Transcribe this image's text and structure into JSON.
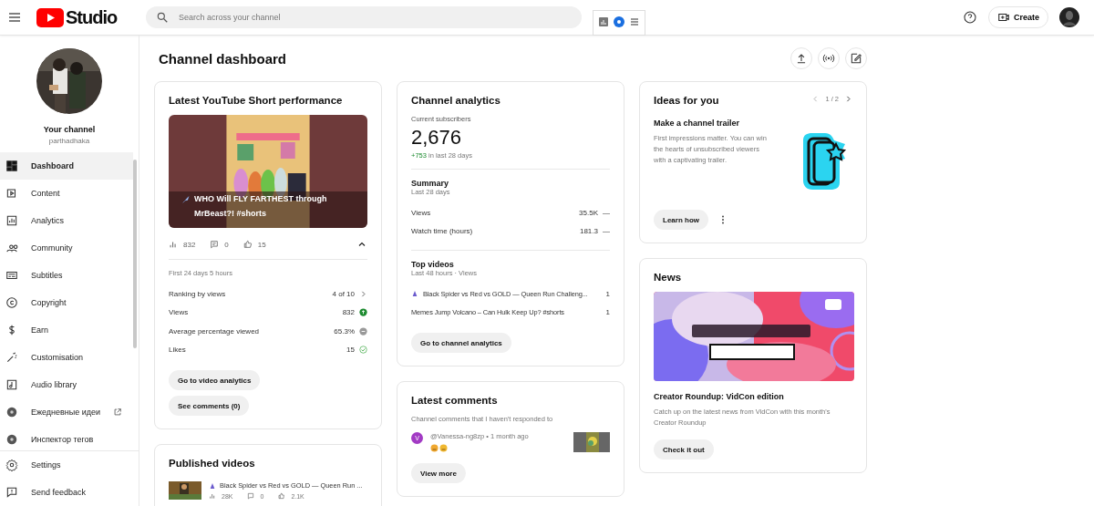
{
  "header": {
    "logo": "Studio",
    "search_placeholder": "Search across your channel",
    "create": "Create"
  },
  "sidebar": {
    "channel_label": "Your channel",
    "channel_handle": "parthadhaka",
    "items": [
      {
        "label": "Dashboard",
        "selected": true,
        "external": false
      },
      {
        "label": "Content",
        "selected": false,
        "external": false
      },
      {
        "label": "Analytics",
        "selected": false,
        "external": false
      },
      {
        "label": "Community",
        "selected": false,
        "external": false
      },
      {
        "label": "Subtitles",
        "selected": false,
        "external": false
      },
      {
        "label": "Copyright",
        "selected": false,
        "external": false
      },
      {
        "label": "Earn",
        "selected": false,
        "external": false
      },
      {
        "label": "Customisation",
        "selected": false,
        "external": false
      },
      {
        "label": "Audio library",
        "selected": false,
        "external": false
      },
      {
        "label": "Ежедневные идеи",
        "selected": false,
        "external": true
      },
      {
        "label": "Инспектор тегов",
        "selected": false,
        "external": false
      }
    ],
    "footer_items": [
      {
        "label": "Settings"
      },
      {
        "label": "Send feedback"
      }
    ]
  },
  "page_title": "Channel dashboard",
  "short_card": {
    "title": "Latest YouTube Short performance",
    "video_title": "WHO Will FLY FARTHEST through MrBeast?! #shorts",
    "views": "832",
    "comments": "0",
    "likes": "15",
    "period": "First 24 days 5 hours",
    "metrics": [
      {
        "label": "Ranking by views",
        "value": "4 of 10",
        "kind": "link"
      },
      {
        "label": "Views",
        "value": "832",
        "kind": "up"
      },
      {
        "label": "Average percentage viewed",
        "value": "65.3%",
        "kind": "neutral"
      },
      {
        "label": "Likes",
        "value": "15",
        "kind": "check"
      }
    ],
    "buttons": [
      "Go to video analytics",
      "See comments (0)"
    ]
  },
  "published_card": {
    "title": "Published videos",
    "videos": [
      {
        "title": "Black Spider vs Red vs GOLD — Queen Run ...",
        "views": "28K",
        "comments": "0",
        "likes": "2.1K"
      }
    ]
  },
  "analytics_card": {
    "title": "Channel analytics",
    "subscribers_label": "Current subscribers",
    "subscribers": "2,676",
    "change": "+753",
    "change_suffix": "in last 28 days",
    "summary_title": "Summary",
    "summary_period": "Last 28 days",
    "summary": [
      {
        "label": "Views",
        "value": "35.5K",
        "trend": "—"
      },
      {
        "label": "Watch time (hours)",
        "value": "181.3",
        "trend": "—"
      }
    ],
    "top_title": "Top videos",
    "top_period": "Last 48 hours · Views",
    "top_videos": [
      {
        "title": "Black Spider vs Red vs GOLD — Queen Run Challeng...",
        "value": "1",
        "short_icon": true
      },
      {
        "title": "Memes Jump Volcano – Can Hulk Keep Up? #shorts",
        "value": "1",
        "short_icon": false
      }
    ],
    "button": "Go to channel analytics"
  },
  "comments_card": {
    "title": "Latest comments",
    "subtitle": "Channel comments that I haven't responded to",
    "comments": [
      {
        "avatar": "V",
        "color": "#a23bc4",
        "meta": "@Vanessa-ng8zp • 1 month ago"
      }
    ],
    "button": "View more"
  },
  "ideas_card": {
    "title": "Ideas for you",
    "pager": "1 / 2",
    "idea_title": "Make a channel trailer",
    "idea_text": "First impressions matter. You can win the hearts of unsubscribed viewers with a captivating trailer.",
    "button": "Learn how"
  },
  "news_card": {
    "title": "News",
    "news_title": "Creator Roundup: VidCon edition",
    "news_text": "Catch up on the latest news from VidCon with this month's Creator Roundup",
    "button": "Check it out"
  }
}
